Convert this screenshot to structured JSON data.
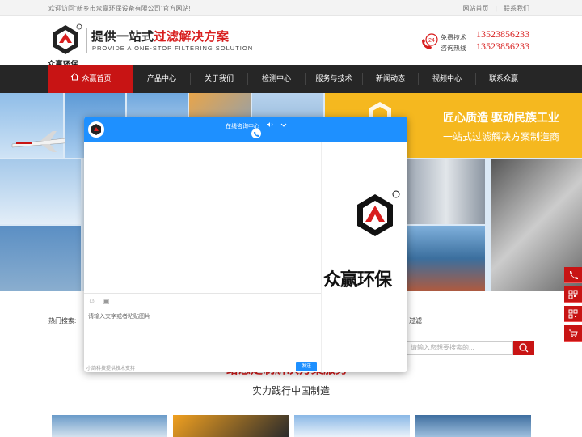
{
  "topbar": {
    "welcome": "欢迎访问“新乡市众赢环保设备有限公司”官方网站!",
    "links": [
      "网站首页",
      "联系我们"
    ],
    "separator": "|"
  },
  "header": {
    "logo_text": "众赢环保",
    "slogan_a": "提供一站式",
    "slogan_b": "过滤解决方案",
    "slogan_en": "PROVIDE A ONE-STOP FILTERING SOLUTION",
    "hotline_labels": [
      "免费技术",
      "咨询热线"
    ],
    "hotline_numbers": [
      "13523856233",
      "13523856233"
    ],
    "hotline_badge": "24"
  },
  "nav": {
    "items": [
      "众赢首页",
      "产品中心",
      "关于我们",
      "检测中心",
      "服务与技术",
      "新闻动态",
      "视频中心",
      "联系众赢"
    ],
    "active_index": 0
  },
  "banner": {
    "headline": "匠心质造 驱动民族工业",
    "subline": "一站式过滤解决方案制造商"
  },
  "search": {
    "hot_label": "热门搜索:",
    "hot_tail": "过滤",
    "placeholder": "请输入您想要搜索的..."
  },
  "section": {
    "title": "给您定制解决方案服务",
    "subtitle": "实力践行中国制造"
  },
  "chat": {
    "title": "在线咨询中心",
    "placeholder": "请输入文字或者粘贴图片",
    "footer": "小韵科技提供技术支持",
    "send_label": "发送",
    "brand_word": "众赢环保"
  },
  "colors": {
    "brand_red": "#c81414",
    "nav_bg": "#262626",
    "chat_blue": "#1e90ff",
    "banner_yellow": "#f5b81f"
  }
}
